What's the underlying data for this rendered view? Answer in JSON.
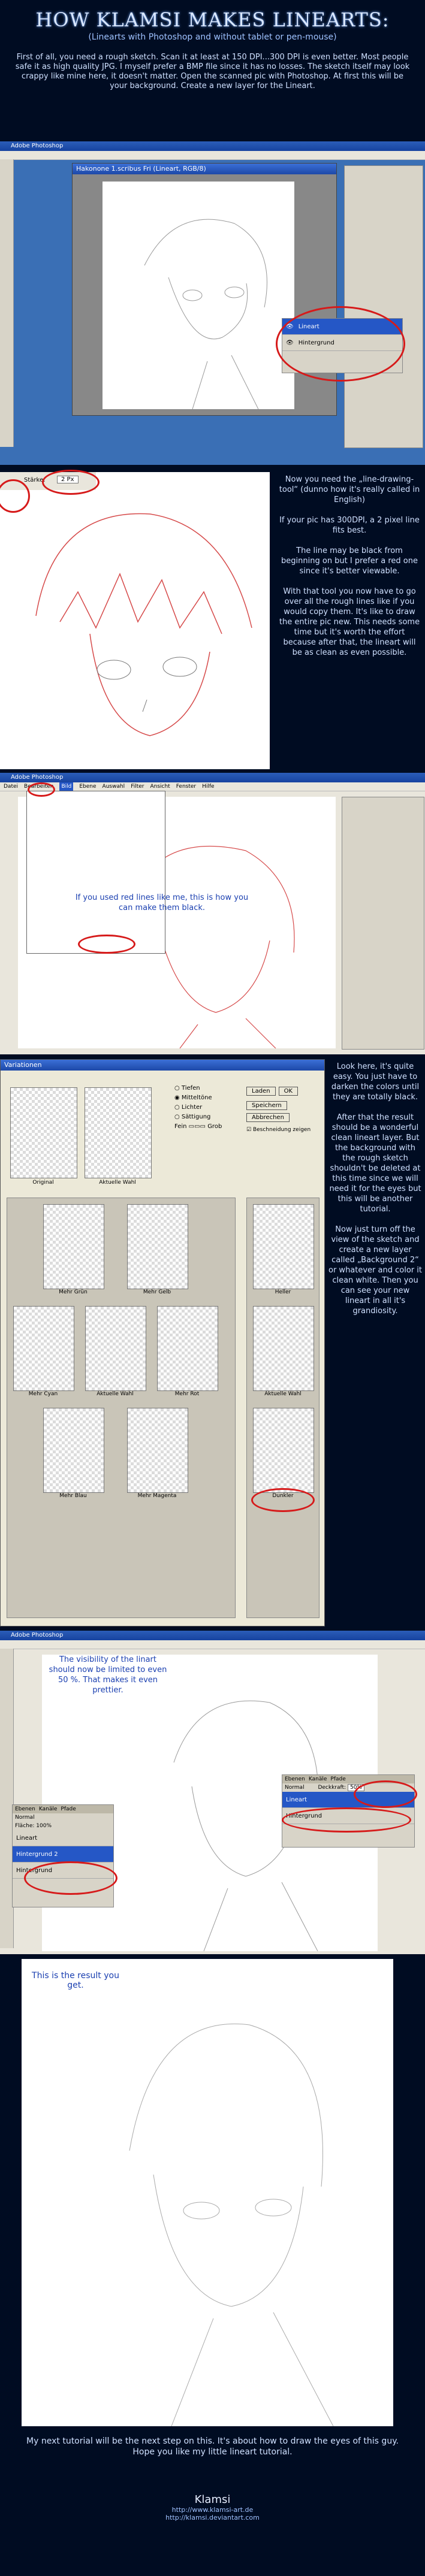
{
  "header": {
    "title": "HOW KLAMSI MAKES LINEARTS:",
    "subtitle": "(Linearts with Photoshop and without tablet or pen-mouse)",
    "intro": "First of all, you need a rough sketch. Scan it at least at 150 DPI...300 DPI is even better. Most people safe it as high quality JPG. I myself prefer a BMP file since it has no losses. The sketch itself may look crappy like mine here, it doesn't matter. Open the scanned pic with Photoshop. At first this will be your background. Create a new layer for the Lineart."
  },
  "step1": {
    "window_title": "Adobe Photoshop",
    "doc_title": "Hakonone 1.scribus Fri (Lineart, RGB/8)",
    "layers": [
      "Lineart",
      "Hintergrund"
    ]
  },
  "step2": {
    "brush_label": "Stärke:",
    "brush_value": "2 Px",
    "text": "Now you need the „line-drawing-tool“ (dunno how it's really called in English)\n\nIf your pic has 300DPI, a 2 pixel line fits best.\n\nThe line may be black from beginning on but I prefer a red one since it's better viewable.\n\nWith that tool you now have to go over all the rough lines like if you would copy them. It's like to draw the entire pic new. This needs some time but it's worth the effort because after that, the lineart will be as clean as even possible."
  },
  "step3": {
    "window_title": "Adobe Photoshop",
    "menu": [
      "Datei",
      "Bearbeiten",
      "Bild",
      "Ebene",
      "Auswahl",
      "Filter",
      "Ansicht",
      "Fenster",
      "Hilfe"
    ],
    "caption": "If you used red lines like me, this is how you can make them black."
  },
  "step4": {
    "dialog_title": "Variationen",
    "options": [
      "Tiefen",
      "Mitteltöne",
      "Lichter",
      "Sättigung"
    ],
    "fine_label": "Fein",
    "coarse_label": "Grob",
    "buttons": [
      "Laden",
      "OK",
      "Speichern",
      "Abbrechen"
    ],
    "preview_label": "Beschneidung zeigen",
    "thumbs_top": [
      "Original",
      "Aktuelle Wahl"
    ],
    "thumbs_grid": [
      "Mehr Grün",
      "Mehr Gelb",
      "Mehr Cyan",
      "Aktuelle Wahl",
      "Mehr Rot",
      "Mehr Blau",
      "Mehr Magenta"
    ],
    "thumbs_right": [
      "Heller",
      "Aktuelle Wahl",
      "Dunkler"
    ],
    "text": "Look here, it's quite easy. You just have to darken the colors until they are totally black.\n\nAfter that the result should be a wonderful clean lineart layer. But the background with the rough sketch shouldn't be deleted at this time since we will need it for the eyes but this will be another tutorial.\n\nNow just turn off the view of the sketch and create a new layer called „Background 2“ or whatever and color it clean white. Then you can see your new lineart in all it's grandiosity."
  },
  "step5": {
    "window_title": "Adobe Photoshop",
    "caption": "The visibility of the linart should now be limited to even 50 %. That makes it even prettier.",
    "layers_left": [
      "Lineart",
      "Hintergrund 2",
      "Hintergrund"
    ],
    "layers_right": [
      "Lineart",
      "Hintergrund"
    ],
    "opacity_label": "Deckkraft:",
    "opacity_value": "50%",
    "fill_label": "Fläche:",
    "fill_value": "100%",
    "mode": "Normal",
    "tabs": [
      "Ebenen",
      "Kanäle",
      "Pfade"
    ]
  },
  "step6": {
    "caption": "This is the result you get."
  },
  "footer": {
    "text": "My next tutorial will be the next step on this. It's about how to draw the eyes of this guy.\nHope you like my little lineart tutorial.",
    "author": "Klamsi",
    "link1": "http://www.klamsi-art.de",
    "link2": "http://klamsi.deviantart.com"
  },
  "colors": {
    "background": "#000c22",
    "accent": "#2557c6",
    "ring": "#d61a1a"
  }
}
